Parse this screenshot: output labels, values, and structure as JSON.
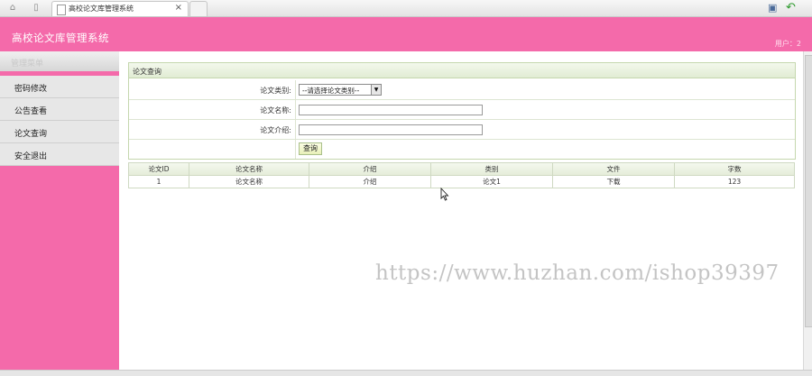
{
  "browser": {
    "tab_title": "高校论文库管理系统",
    "tab_close": "×",
    "icons": [
      "home-icon",
      "page-icon",
      "document-icon",
      "bookmark-icon",
      "back-arrow-icon"
    ]
  },
  "app": {
    "title": "高校论文库管理系统",
    "status": "用户：2",
    "colors": {
      "brand_pink": "#f46aaa",
      "panel_green": "#c5d7ae"
    }
  },
  "sidebar": {
    "header": "管理菜单",
    "items": [
      {
        "label": "密码修改"
      },
      {
        "label": "公告查看"
      },
      {
        "label": "论文查询"
      },
      {
        "label": "安全退出"
      }
    ]
  },
  "search": {
    "title": "论文查询",
    "category_label": "论文类别:",
    "category_selected": "--请选择论文类别--",
    "name_label": "论文名称:",
    "name_value": "",
    "intro_label": "论文介绍:",
    "intro_value": "",
    "query_button": "查询"
  },
  "results": {
    "columns": [
      "论文ID",
      "论文名称",
      "介绍",
      "类别",
      "文件",
      "字数"
    ],
    "rows": [
      [
        "1",
        "论文名称",
        "介绍",
        "论文1",
        "下载",
        "123"
      ]
    ]
  },
  "watermark": "https://www.huzhan.com/ishop39397"
}
